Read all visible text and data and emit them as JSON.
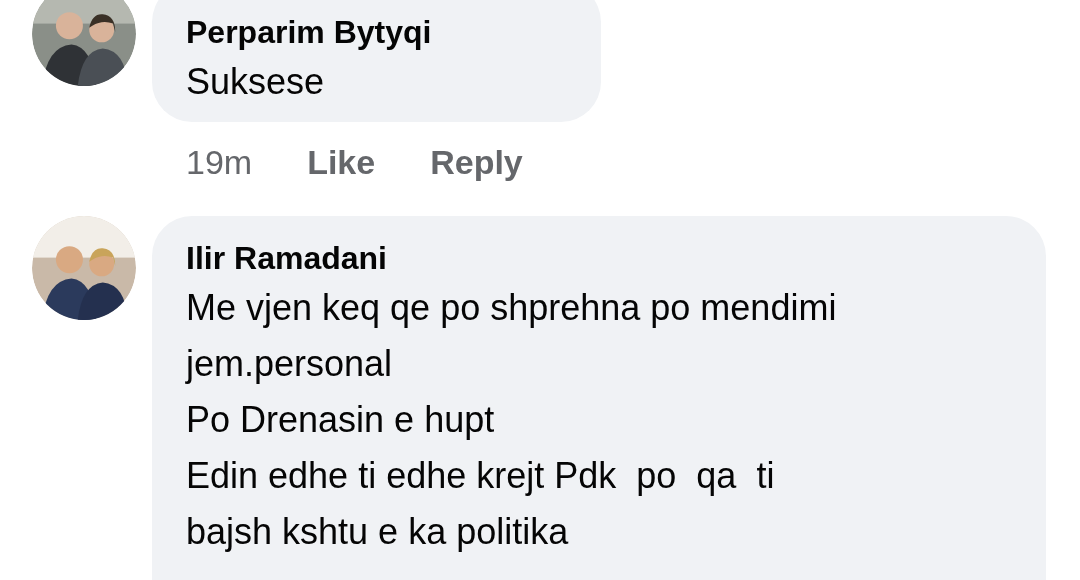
{
  "comments": [
    {
      "author": "Perparim Bytyqi",
      "text": "Suksese",
      "meta": {
        "time": "19m",
        "actions": [
          "Like",
          "Reply"
        ]
      }
    },
    {
      "author": "Ilir Ramadani",
      "text": "Me vjen keq qe po shprehna po mendimi\njem.personal\nPo Drenasin e hupt\nEdin edhe ti edhe krejt Pdk  po  qa  ti\nbajsh kshtu e ka politika"
    }
  ]
}
